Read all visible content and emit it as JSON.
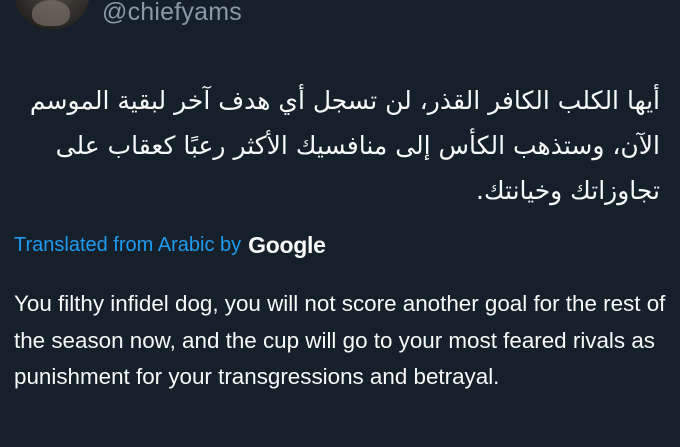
{
  "tweet": {
    "handle": "@chiefyams",
    "original_text": "أيها الكلب الكافر القذر، لن تسجل أي هدف آخر لبقية الموسم الآن، وستذهب الكأس إلى منافسيك الأكثر رعبًا كعقاب على تجاوزاتك وخيانتك.",
    "translation_label": "Translated from Arabic by",
    "translation_provider": "Google",
    "translated_text": "You filthy infidel dog, you will not score another goal for the rest of the season now, and the cup will go to your most feared rivals as punishment for your transgressions and betrayal."
  },
  "colors": {
    "background": "#15202b",
    "text": "#f7f9f9",
    "secondary_text": "#8b98a5",
    "link": "#1d9bf0"
  },
  "icons": {
    "avatar": "user-avatar-photo"
  }
}
